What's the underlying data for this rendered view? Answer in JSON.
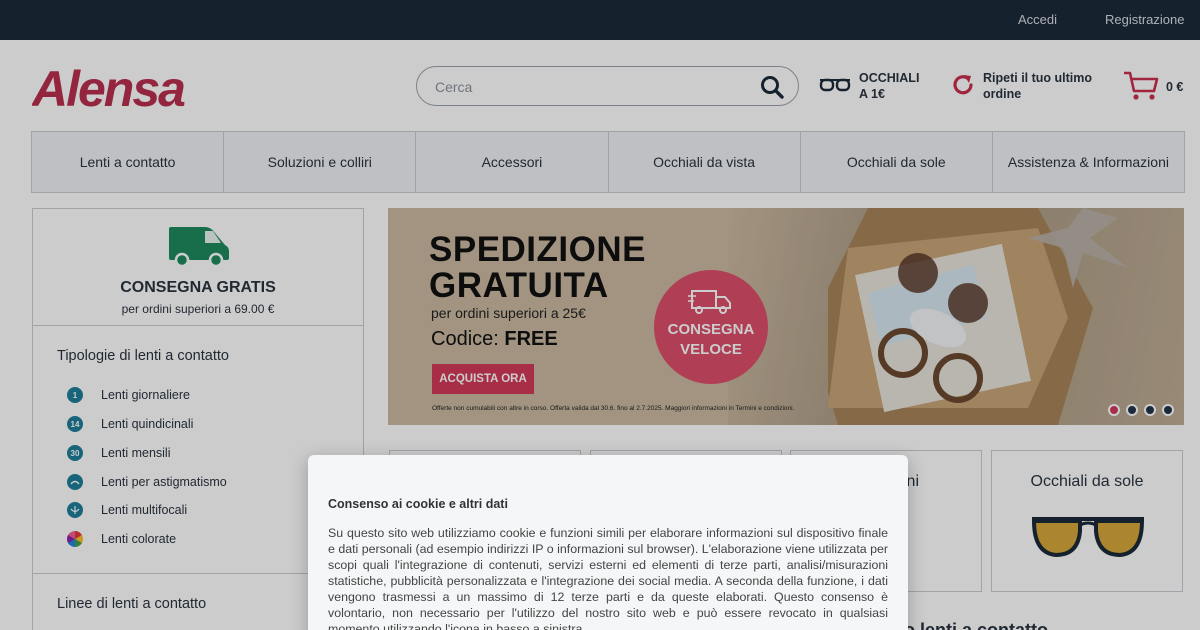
{
  "topbar": {
    "login": "Accedi",
    "register": "Registrazione"
  },
  "logo": {
    "text": "Alensa",
    "color": "#b8304e"
  },
  "search": {
    "placeholder": "Cerca",
    "icon": "search-icon"
  },
  "header": {
    "glasses_promo": {
      "line1": "OCCHIALI",
      "line2": "A 1€",
      "icon": "glasses-icon"
    },
    "reorder": {
      "line1": "Ripeti il tuo ultimo",
      "line2": "ordine",
      "icon": "reorder-icon"
    },
    "cart": {
      "total": "0 €",
      "icon": "cart-icon"
    }
  },
  "nav": {
    "tabs": [
      "Lenti a contatto",
      "Soluzioni e colliri",
      "Accessori",
      "Occhiali da vista",
      "Occhiali da sole",
      "Assistenza & Informazioni"
    ]
  },
  "sidebar": {
    "shipping": {
      "title": "CONSEGNA GRATIS",
      "subtitle": "per ordini superiori a 69.00 €",
      "icon": "delivery-truck-icon"
    },
    "types_title": "Tipologie di lenti a contatto",
    "types": [
      {
        "icon_text": "1",
        "label": "Lenti giornaliere"
      },
      {
        "icon_text": "14",
        "label": "Lenti quindicinali"
      },
      {
        "icon_text": "30",
        "label": "Lenti mensili"
      },
      {
        "icon_text": "",
        "label": "Lenti per astigmatismo"
      },
      {
        "icon_text": "",
        "label": "Lenti multifocali"
      },
      {
        "icon_text": "",
        "label": "Lenti colorate"
      }
    ],
    "lines_title": "Linee di lenti a contatto"
  },
  "banner": {
    "headline1": "SPEDIZIONE",
    "headline2": "GRATUITA",
    "subline": "per ordini superiori a 25€",
    "code_label": "Codice:",
    "code_value": "FREE",
    "cta": "ACQUISTA ORA",
    "fine_print": "Offerte non cumulabili con altre in corso. Offerta valida dal 30.6. fino al 2.7.2025. Maggiori informazioni in Termini e condizioni.",
    "badge_line1": "CONSEGNA",
    "badge_line2": "VELOCE",
    "slide_count": 4,
    "active_slide": 1
  },
  "cards": [
    {
      "title": ""
    },
    {
      "title": ""
    },
    {
      "title": "ni"
    },
    {
      "title": "Occhiali da sole"
    }
  ],
  "section_partial_title": "o lenti a contatto",
  "cookie": {
    "title": "Consenso ai cookie e altri dati",
    "body": "Su questo sito web utilizziamo cookie e funzioni simili per elaborare informazioni sul dispositivo finale e dati personali (ad esempio indirizzi IP o informazioni sul browser). L'elaborazione viene utilizzata per scopi quali l'integrazione di contenuti, servizi esterni ed elementi di terze parti, analisi/misurazioni statistiche, pubblicità personalizzata e l'integrazione dei social media. A seconda della funzione, i dati vengono trasmessi a un massimo di 12 terze parti e da queste elaborati. Questo consenso è volontario, non necessario per l'utilizzo del nostro sito web e può essere revocato in qualsiasi momento utilizzando l'icona in basso a sinistra."
  },
  "colors": {
    "accent": "#d33a5a",
    "nav_bg": "#eef1f4",
    "topbar": "#1c2a3a",
    "truck": "#1e8a5e"
  }
}
